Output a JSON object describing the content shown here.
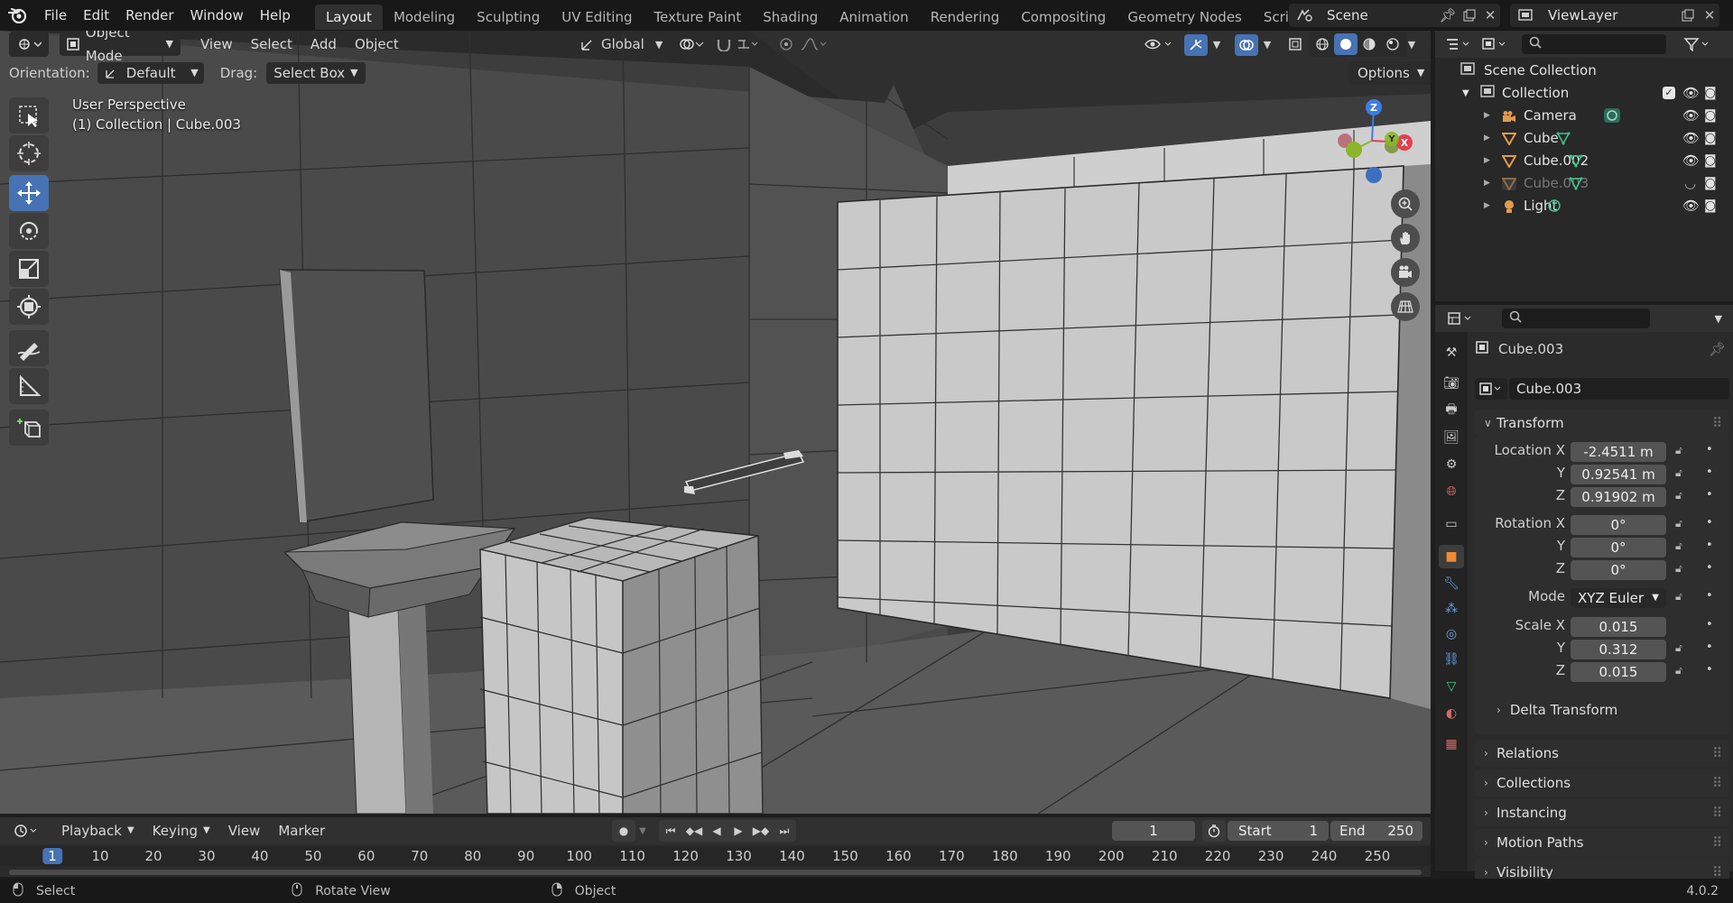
{
  "menu": {
    "items": [
      "File",
      "Edit",
      "Render",
      "Window",
      "Help"
    ]
  },
  "workspaces": {
    "tabs": [
      "Layout",
      "Modeling",
      "Sculpting",
      "UV Editing",
      "Texture Paint",
      "Shading",
      "Animation",
      "Rendering",
      "Compositing",
      "Geometry Nodes",
      "Scripting"
    ],
    "active": "Layout",
    "add": "+"
  },
  "scene": {
    "name": "Scene",
    "view_layer": "ViewLayer"
  },
  "viewport": {
    "mode": "Object Mode",
    "menus": [
      "View",
      "Select",
      "Add",
      "Object"
    ],
    "transform_orientation": "Global",
    "orientation_label": "Orientation:",
    "orientation_value": "Default",
    "drag_label": "Drag:",
    "drag_value": "Select Box",
    "options": "Options",
    "perspective_text": "User Perspective",
    "context_text": "(1) Collection | Cube.003",
    "gizmo": {
      "z": "Z",
      "y": "Y",
      "x": "X"
    }
  },
  "outliner": {
    "root": "Scene Collection",
    "collection": "Collection",
    "items": [
      {
        "name": "Camera",
        "icon": "camera-icon",
        "color": "#e39a4e",
        "dim": false
      },
      {
        "name": "Cube",
        "icon": "mesh-icon",
        "color": "#e39a4e",
        "dim": false
      },
      {
        "name": "Cube.002",
        "icon": "mesh-icon",
        "color": "#e39a4e",
        "dim": false
      },
      {
        "name": "Cube.003",
        "icon": "mesh-icon",
        "color": "#e39a4e",
        "dim": true
      },
      {
        "name": "Light",
        "icon": "light-icon",
        "color": "#e39a4e",
        "dim": false
      }
    ]
  },
  "properties": {
    "object_name": "Cube.003",
    "data_name": "Cube.003",
    "transform": {
      "title": "Transform",
      "location": {
        "label": "Location X",
        "x": "-2.4511 m",
        "y": "0.92541 m",
        "z": "0.91902 m"
      },
      "rotation": {
        "label": "Rotation X",
        "x": "0°",
        "y": "0°",
        "z": "0°"
      },
      "mode": {
        "label": "Mode",
        "value": "XYZ Euler"
      },
      "scale": {
        "label": "Scale X",
        "x": "0.015",
        "y": "0.312",
        "z": "0.015"
      },
      "axis_y": "Y",
      "axis_z": "Z",
      "delta": "Delta Transform"
    },
    "panels": [
      "Relations",
      "Collections",
      "Instancing",
      "Motion Paths",
      "Visibility"
    ]
  },
  "timeline": {
    "menus": [
      "Playback",
      "Keying",
      "View",
      "Marker"
    ],
    "current_frame": "1",
    "start_label": "Start",
    "start": "1",
    "end_label": "End",
    "end": "250",
    "ticks": [
      "1",
      "10",
      "20",
      "30",
      "40",
      "50",
      "60",
      "70",
      "80",
      "90",
      "100",
      "110",
      "120",
      "130",
      "140",
      "150",
      "160",
      "170",
      "180",
      "190",
      "200",
      "210",
      "220",
      "230",
      "240",
      "250"
    ]
  },
  "statusbar": {
    "select": "Select",
    "rotate": "Rotate View",
    "object": "Object",
    "version": "4.0.2"
  },
  "colors": {
    "accent": "#4772b3",
    "object_orange": "#e39a4e",
    "active_orange": "#f28a33",
    "axis_x": "#e2404f",
    "axis_y": "#8bb62a",
    "axis_z": "#3d7ee3"
  }
}
